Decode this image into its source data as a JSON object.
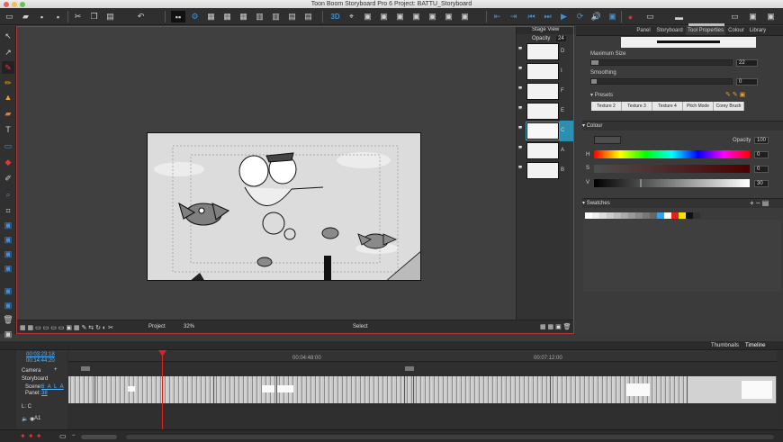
{
  "window": {
    "title": "Toon Boom Storyboard Pro 6 Project: BATTU_Storyboard"
  },
  "stage_view": {
    "header": "Stage View",
    "opacity_label": "Opacity",
    "opacity_value": "24",
    "panels": [
      {
        "label": "D"
      },
      {
        "label": "I"
      },
      {
        "label": "F"
      },
      {
        "label": "E"
      },
      {
        "label": "C"
      },
      {
        "label": "A"
      },
      {
        "label": "B"
      }
    ]
  },
  "stage_bar": {
    "project_label": "Project",
    "zoom": "32%",
    "center_label": "Select"
  },
  "right_panel": {
    "tabs": [
      "Panel",
      "Storyboard",
      "Tool Properties",
      "Colour",
      "Library"
    ],
    "maximum_size_label": "Maximum Size",
    "maximum_size_value": "22",
    "maximum_size_fraction": 0.05,
    "smoothing_label": "Smoothing",
    "smoothing_value": "0",
    "presets_label": "Presets",
    "presets": [
      "Texture 2",
      "Texture 3",
      "Texture 4",
      "Pitch Mode",
      "Corey Brush"
    ],
    "colour_header": "Colour",
    "opacity_label": "Opacity",
    "opacity_value": "100",
    "h_label": "H",
    "h_value": "0",
    "s_label": "S",
    "s_value": "0",
    "v_label": "V",
    "v_value": "30",
    "v_fraction": 0.3,
    "swatches_label": "Swatches",
    "swatch_colors": [
      "#ffffff",
      "#eeeeee",
      "#dddddd",
      "#cccccc",
      "#bbbbbb",
      "#aaaaaa",
      "#999999",
      "#888888",
      "#777777",
      "#666666",
      "#3aa0e8",
      "#ffffff",
      "#e3221b",
      "#f6e400",
      "#111111",
      "#333333"
    ]
  },
  "timeline": {
    "tabs": [
      "Thumbnails",
      "Timeline"
    ],
    "timecode": "00:03:23:18",
    "duration": "00:14:44:20",
    "ruler_marks": [
      "00:04:48:00",
      "00:07:12:00"
    ],
    "camera_label": "Camera",
    "storyboard_label": "Storyboard",
    "scene_label": "Scene:",
    "scene_value": "6_A_L_A",
    "panel_label": "Panel:",
    "panel_value": "38",
    "layer_lc": "L: C",
    "layer_a1": "A1"
  }
}
